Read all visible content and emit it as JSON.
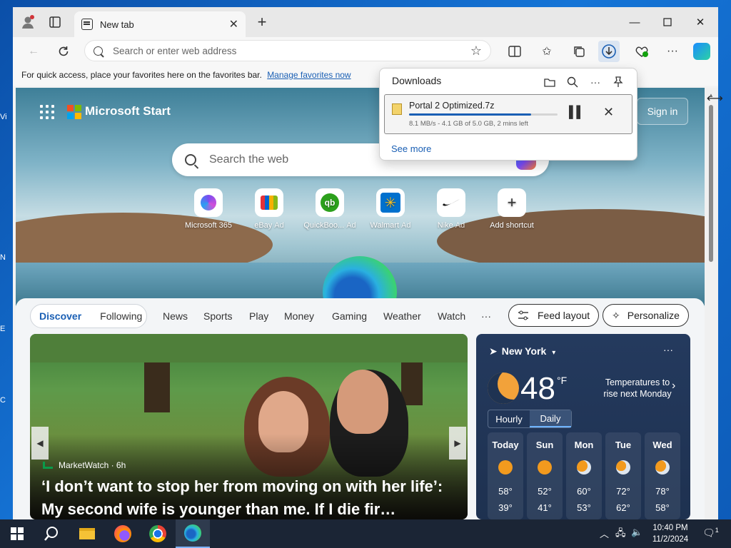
{
  "browser": {
    "tab_title": "New tab",
    "address_placeholder": "Search or enter web address",
    "favorites_bar_text": "For quick access, place your favorites here on the favorites bar.",
    "favorites_bar_link": "Manage favorites now"
  },
  "downloads": {
    "title": "Downloads",
    "file_name": "Portal 2 Optimized.7z",
    "status": "8.1 MB/s - 4.1 GB of 5.0 GB, 2 mins left",
    "progress": 0.82,
    "see_more": "See more"
  },
  "start": {
    "brand": "Microsoft Start",
    "sign_in": "Sign in",
    "search_placeholder": "Search the web",
    "shortcuts": [
      {
        "label": "Microsoft 365",
        "ad": ""
      },
      {
        "label": "eBay",
        "ad": "Ad"
      },
      {
        "label": "QuickBoo...",
        "ad": "Ad"
      },
      {
        "label": "Walmart",
        "ad": "Ad"
      },
      {
        "label": "Nike",
        "ad": "Ad"
      },
      {
        "label": "Add shortcut",
        "ad": ""
      }
    ]
  },
  "feed": {
    "tabs": [
      "Discover",
      "Following"
    ],
    "nav": [
      "News",
      "Sports",
      "Play",
      "Money",
      "Gaming",
      "Weather",
      "Watch",
      "···"
    ],
    "feed_layout": "Feed layout",
    "personalize": "Personalize",
    "article": {
      "source": "MarketWatch · 6h",
      "title": "‘I don’t want to stop her from moving on with her life’: My second wife is younger than me. If I die fir…"
    }
  },
  "weather": {
    "location": "New York",
    "temp": "48",
    "unit": "°F",
    "alert": "Temperatures to rise next Monday",
    "toggle": [
      "Hourly",
      "Daily"
    ],
    "days": [
      {
        "day": "Today",
        "hi": "58°",
        "lo": "39°"
      },
      {
        "day": "Sun",
        "hi": "52°",
        "lo": "41°"
      },
      {
        "day": "Mon",
        "hi": "60°",
        "lo": "53°"
      },
      {
        "day": "Tue",
        "hi": "72°",
        "lo": "62°"
      },
      {
        "day": "Wed",
        "hi": "78°",
        "lo": "58°"
      }
    ]
  },
  "taskbar": {
    "time": "10:40 PM",
    "date": "11/2/2024",
    "notification_count": "1"
  },
  "desktop_icon_letters": [
    "Vi",
    "",
    "N",
    "E",
    "C"
  ],
  "colors": {
    "accent": "#1a5fb4",
    "taskbar": "#1b2535",
    "weather_bg": "#243a5e"
  }
}
